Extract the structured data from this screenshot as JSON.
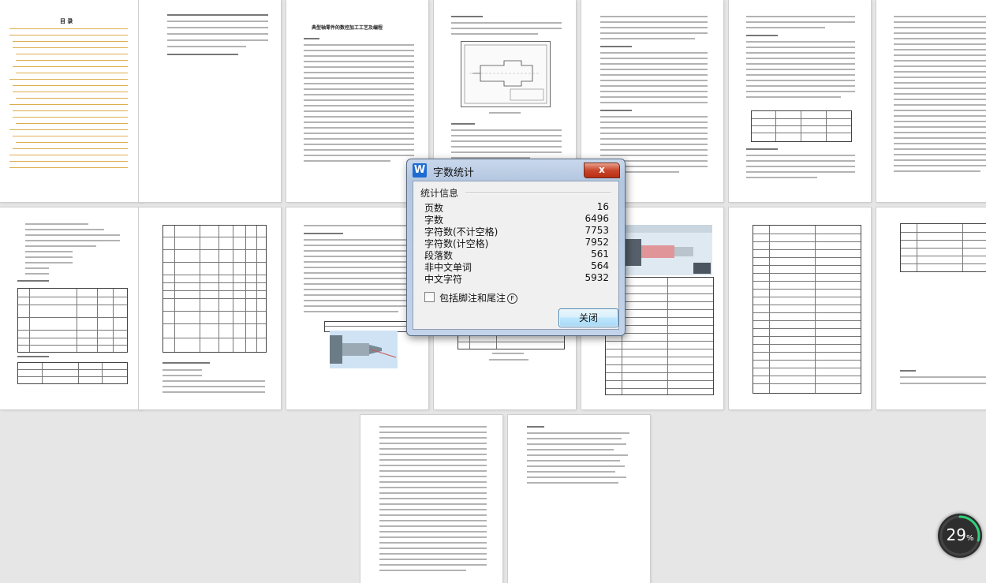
{
  "dialog": {
    "title": "字数统计",
    "close_x": "x",
    "group_title": "统计信息",
    "stats": [
      {
        "label": "页数",
        "value": "16"
      },
      {
        "label": "字数",
        "value": "6496"
      },
      {
        "label": "字符数(不计空格)",
        "value": "7753"
      },
      {
        "label": "字符数(计空格)",
        "value": "7952"
      },
      {
        "label": "段落数",
        "value": "561"
      },
      {
        "label": "非中文单词",
        "value": "564"
      },
      {
        "label": "中文字符",
        "value": "5932"
      }
    ],
    "checkbox_label": "包括脚注和尾注",
    "checkbox_hotkey": "F",
    "checkbox_checked": false,
    "close_button": "关闭"
  },
  "thumbnails": {
    "toc_title": "目 录",
    "paper_title": "典型轴零件的数控加工工艺及编程",
    "app_icon": "W"
  },
  "progress": {
    "value": "29",
    "unit": "%",
    "fraction": 0.29,
    "color": "#2fd27a"
  }
}
